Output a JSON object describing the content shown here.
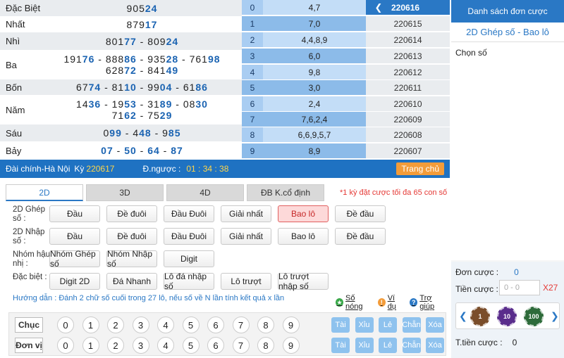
{
  "results": [
    {
      "label": "Đặc Biệt",
      "lines": [
        [
          [
            "905",
            ""
          ],
          [
            "24",
            "b"
          ]
        ]
      ]
    },
    {
      "label": "Nhất",
      "lines": [
        [
          [
            "879",
            ""
          ],
          [
            "17",
            "b"
          ]
        ]
      ]
    },
    {
      "label": "Nhì",
      "lines": [
        [
          [
            "801",
            ""
          ],
          [
            "77",
            "b"
          ],
          [
            " - 809",
            ""
          ],
          [
            "24",
            "b"
          ]
        ]
      ]
    },
    {
      "label": "Ba",
      "lines": [
        [
          [
            "191",
            ""
          ],
          [
            "76",
            "b"
          ],
          [
            " - 888",
            ""
          ],
          [
            "86",
            "b"
          ],
          [
            " - 935",
            ""
          ],
          [
            "28",
            "b"
          ],
          [
            " - 761",
            ""
          ],
          [
            "98",
            "b"
          ]
        ],
        [
          [
            "628",
            ""
          ],
          [
            "72",
            "b"
          ],
          [
            " - 841",
            ""
          ],
          [
            "49",
            "b"
          ]
        ]
      ]
    },
    {
      "label": "Bốn",
      "lines": [
        [
          [
            "67",
            ""
          ],
          [
            "74",
            "b"
          ],
          [
            " - 81",
            ""
          ],
          [
            "10",
            "b"
          ],
          [
            " - 99",
            ""
          ],
          [
            "04",
            "b"
          ],
          [
            " - 61",
            ""
          ],
          [
            "86",
            "b"
          ]
        ]
      ]
    },
    {
      "label": "Năm",
      "lines": [
        [
          [
            "14",
            ""
          ],
          [
            "36",
            "b"
          ],
          [
            " - 19",
            ""
          ],
          [
            "53",
            "b"
          ],
          [
            " - 31",
            ""
          ],
          [
            "89",
            "b"
          ],
          [
            " - 08",
            ""
          ],
          [
            "30",
            "b"
          ]
        ],
        [
          [
            "71",
            ""
          ],
          [
            "62",
            "b"
          ],
          [
            " - 75",
            ""
          ],
          [
            "29",
            "b"
          ]
        ]
      ]
    },
    {
      "label": "Sáu",
      "lines": [
        [
          [
            "0",
            ""
          ],
          [
            "99",
            "b"
          ],
          [
            " - 4",
            ""
          ],
          [
            "48",
            "b"
          ],
          [
            " - 9",
            ""
          ],
          [
            "85",
            "b"
          ]
        ]
      ]
    },
    {
      "label": "Bảy",
      "lines": [
        [
          [
            "07",
            "b"
          ],
          [
            " - ",
            ""
          ],
          [
            "50",
            "b"
          ],
          [
            " - ",
            ""
          ],
          [
            "64",
            "b"
          ],
          [
            " - ",
            ""
          ],
          [
            "87",
            "b"
          ]
        ]
      ]
    }
  ],
  "numbered_list": [
    {
      "idx": "0",
      "val": "4,7"
    },
    {
      "idx": "1",
      "val": "7,0"
    },
    {
      "idx": "2",
      "val": "4,4,8,9"
    },
    {
      "idx": "3",
      "val": "6,0"
    },
    {
      "idx": "4",
      "val": "9,8"
    },
    {
      "idx": "5",
      "val": "3,0"
    },
    {
      "idx": "6",
      "val": "2,4"
    },
    {
      "idx": "7",
      "val": "7,6,2,4"
    },
    {
      "idx": "8",
      "val": "6,6,9,5,7"
    },
    {
      "idx": "9",
      "val": "8,9"
    }
  ],
  "periods": [
    "220616",
    "220615",
    "220614",
    "220613",
    "220612",
    "220611",
    "220610",
    "220609",
    "220608",
    "220607"
  ],
  "infobar": {
    "station": "Đài chính-Hà Nội",
    "ky_label": "Kỳ",
    "ky_value": "220617",
    "countdown_label": "Đ.ngược :",
    "countdown_value": "01 : 34 : 38",
    "home_label": "Trang chủ"
  },
  "tabs": [
    "2D",
    "3D",
    "4D",
    "ĐB K.cổ định"
  ],
  "warning": "*1 kỳ đặt cược tối đa 65 con số",
  "rows": [
    {
      "label": "2D Ghép số :",
      "buttons": [
        "Đầu",
        "Đề đuôi",
        "Đầu Đuôi",
        "Giải nhất",
        "Bao lô",
        "Đề đầu"
      ]
    },
    {
      "label": "2D Nhập số :",
      "buttons": [
        "Đầu",
        "Đề đuôi",
        "Đầu Đuôi",
        "Giải nhất",
        "Bao lô",
        "Đề đầu"
      ]
    },
    {
      "label": "Nhóm hậu nhị :",
      "buttons": [
        "Nhóm Ghép số",
        "Nhóm Nhập số",
        "Digit"
      ]
    },
    {
      "label": "Đặc biệt :",
      "buttons": [
        "Digit 2D",
        "Đá Nhanh",
        "Lô đá nhập số",
        "Lô trượt",
        "Lô trượt nhập số"
      ]
    }
  ],
  "guide": "Hướng dẫn : Đánh 2 chữ số cuối trong 27 lô, nếu số về N lần tính kết quả x lần",
  "tools": {
    "hot": "Số nóng",
    "example": "Ví dụ",
    "help": "Trợ giúp"
  },
  "pad": {
    "rows": [
      "Chục",
      "Đơn vị"
    ],
    "digits": [
      "0",
      "1",
      "2",
      "3",
      "4",
      "5",
      "6",
      "7",
      "8",
      "9"
    ],
    "quick": [
      "Tài",
      "Xỉu",
      "Lẻ",
      "Chẵn",
      "Xóa"
    ]
  },
  "right": {
    "header": "Danh sách đơn cược",
    "subheader": "2D Ghép số - Bao lô",
    "pick_label": "Chọn số",
    "don_cuoc_label": "Đơn cược :",
    "don_cuoc_value": "0",
    "tien_cuoc_label": "Tiền cược :",
    "tien_cuoc_placeholder": "0 - 0",
    "multiplier": "X27",
    "chips": [
      "1",
      "10",
      "100"
    ],
    "total_label": "T.tiền cược :",
    "total_value": "0"
  }
}
